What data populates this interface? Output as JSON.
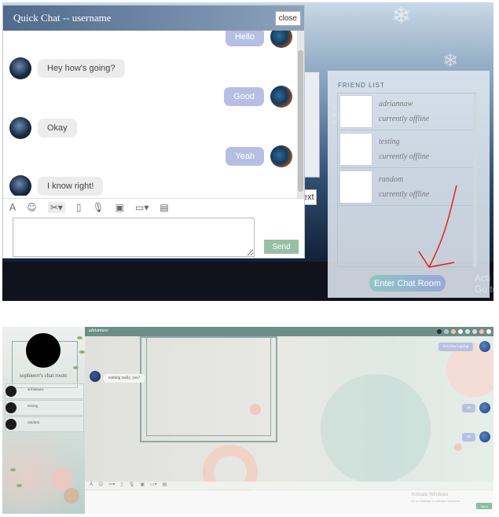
{
  "chat": {
    "title": "Quick Chat -- username",
    "close_label": "close",
    "messages": [
      {
        "side": "right",
        "text": "Hello"
      },
      {
        "side": "left",
        "text": "Hey how's going?"
      },
      {
        "side": "right",
        "text": "Good"
      },
      {
        "side": "left",
        "text": "Okay"
      },
      {
        "side": "right",
        "text": "Yeah"
      },
      {
        "side": "left",
        "text": "I know right!"
      }
    ],
    "toolbar": [
      "A",
      "☺",
      "✂▾",
      "▯",
      "🎙",
      "▣",
      "▭▾",
      "▤"
    ],
    "send_label": "Send"
  },
  "background": {
    "ext_label": "ext"
  },
  "friend_list": {
    "title": "FRIEND LIST",
    "friends": [
      {
        "name": "adriannaw",
        "status": "currently offline"
      },
      {
        "name": "testing",
        "status": "currently offline"
      },
      {
        "name": "random",
        "status": "currently offline"
      }
    ],
    "enter_label": "Enter Chat Room",
    "watermark": "Acti\nGo to"
  },
  "room": {
    "header_title": "adriannaw",
    "room_label": "sophieerr's chat room",
    "sidebar_users": [
      "adriannaw",
      "testing",
      "random"
    ],
    "messages": [
      {
        "side": "right",
        "text": "hey,how's going"
      },
      {
        "side": "left",
        "text": "nothing really, you?"
      },
      {
        "side": "right",
        "text": "ok"
      },
      {
        "side": "right",
        "text": "ok"
      }
    ],
    "toolbar": [
      "A",
      "☺",
      "✂▾",
      "▯",
      "🎙",
      "▣",
      "▭▾",
      "▤"
    ],
    "send_label": "Send",
    "watermark_title": "Activate Windows",
    "watermark_sub": "Go to Settings to activate Windows.",
    "theme_dots": [
      "#2b2b2b",
      "#b8c4d0",
      "#f2c7a8",
      "#ffffff",
      "#d9e7e0",
      "#e7d3e6",
      "#f7b9b9",
      "#ffffff"
    ]
  }
}
